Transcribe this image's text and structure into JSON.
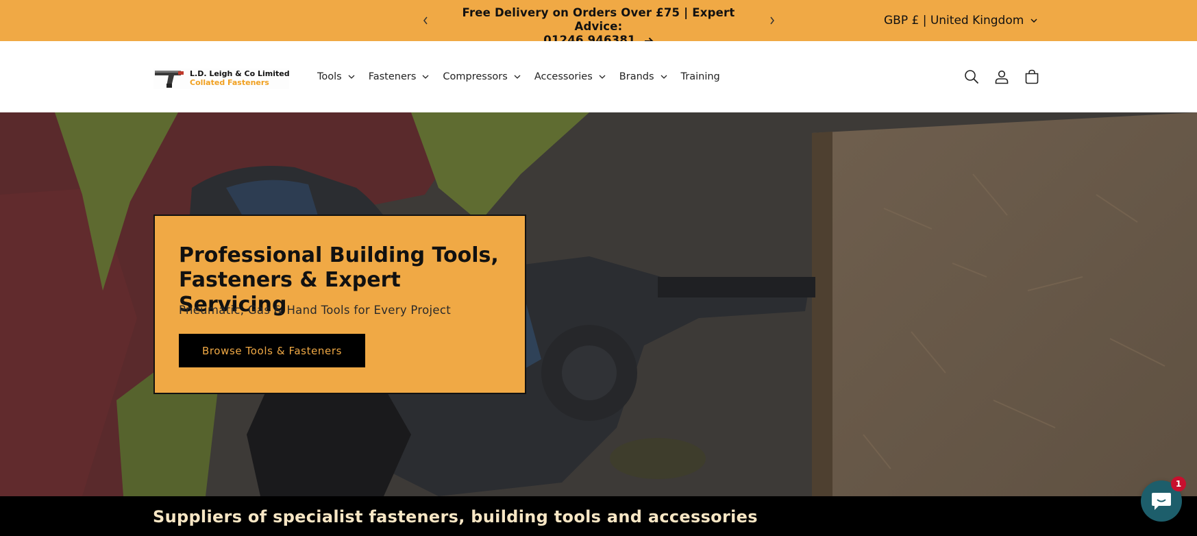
{
  "announcement": {
    "line1": "Free Delivery on Orders Over £75 | Expert Advice:",
    "line2": "01246 946381",
    "prev_icon": "chevron-left-icon",
    "next_icon": "chevron-right-icon"
  },
  "localization": {
    "label": "GBP £ | United Kingdom"
  },
  "logo": {
    "line1": "L.D. Leigh & Co Limited",
    "line2": "Collated Fasteners"
  },
  "nav": {
    "items": [
      {
        "label": "Tools",
        "has_dropdown": true
      },
      {
        "label": "Fasteners",
        "has_dropdown": true
      },
      {
        "label": "Compressors",
        "has_dropdown": true
      },
      {
        "label": "Accessories",
        "has_dropdown": true
      },
      {
        "label": "Brands",
        "has_dropdown": true
      },
      {
        "label": "Training",
        "has_dropdown": false
      }
    ]
  },
  "header_icons": [
    "search-icon",
    "account-icon",
    "cart-icon"
  ],
  "hero": {
    "title": "Professional Building Tools, Fasteners & Expert Servicing",
    "subtitle": "Pneumatic, Gas & Hand Tools for Every Project",
    "cta": "Browse Tools & Fasteners"
  },
  "strip": {
    "heading": "Suppliers of specialist fasteners, building tools and accessories"
  },
  "chat": {
    "badge": "1"
  },
  "colors": {
    "accent": "#f0a945",
    "dark": "#000000",
    "chat": "#1d5e6b",
    "badge": "#c8102e"
  }
}
